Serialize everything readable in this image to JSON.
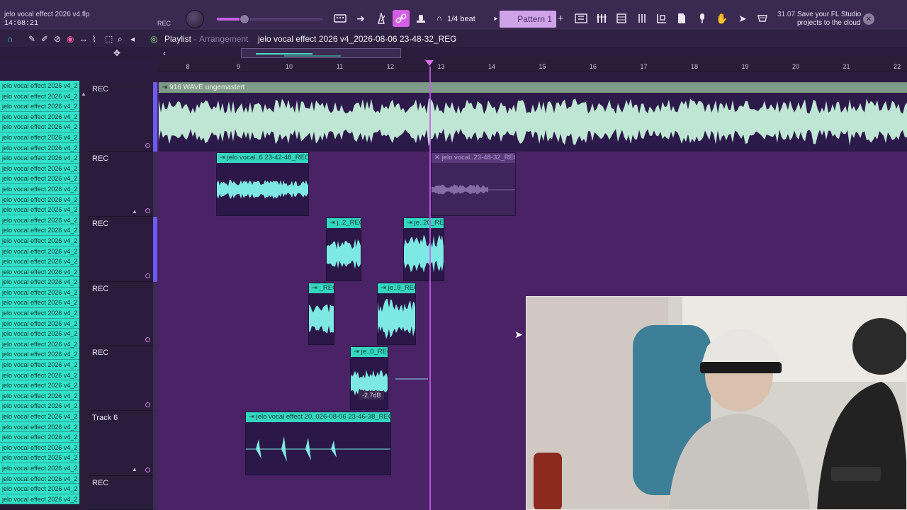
{
  "app": {
    "project_file": "jelo vocal effect 2026 v4.flp",
    "time": "14:08:21",
    "rec_label": "REC"
  },
  "toolbar": {
    "snap": "1/4 beat",
    "pattern": "Pattern 1",
    "pattern_add": "+",
    "cloud_count": "31.07",
    "cloud_message": "Save your FL Studio projects to the cloud",
    "icons": [
      "typing-keyboard-icon",
      "arrow-right-icon",
      "metronome-icon",
      "link-icon",
      "stamp-icon",
      "wait-icon",
      "mixer-icon",
      "channel-rack-icon",
      "piano-roll-icon",
      "browser-icon",
      "plugin-icon",
      "project-icon",
      "cloud-icon"
    ]
  },
  "playlist": {
    "title": "Playlist",
    "separator": "-",
    "subtitle": "Arrangement",
    "project_name": "jelo vocal effect 2026 v4_2026-08-06 23-48-32_REC",
    "crumb_arrow": "›"
  },
  "ruler": {
    "bars": [
      "8",
      "9",
      "10",
      "11",
      "12",
      "13",
      "14",
      "15",
      "16",
      "17",
      "18",
      "19",
      "20",
      "21",
      "22"
    ]
  },
  "clip_list": {
    "item_label": "jelo vocal effect 2026 v4_2",
    "count": 41
  },
  "tracks": [
    {
      "name": "REC",
      "accent": true
    },
    {
      "name": "REC",
      "accent": false
    },
    {
      "name": "REC",
      "accent": true
    },
    {
      "name": "REC",
      "accent": false
    },
    {
      "name": "REC",
      "accent": false
    },
    {
      "name": "Track 6",
      "accent": false
    },
    {
      "name": "REC",
      "accent": false
    }
  ],
  "clips": {
    "main_audio": "916 WAVE ungemastert",
    "track2_a": "jelo vocal..6 23-42-48_REC",
    "track2_b": "jelo vocal..23-48-32_REC",
    "track3_a": "j..2_REC",
    "track3_b": "je..20_REC",
    "track4_a": "_REC",
    "track4_b": "je..9_REC",
    "track5_a": "je..0_REC",
    "track6_a": "jelo vocal effect 20..026-08-06 23-46-38_REC",
    "gain": "-2.7dB"
  },
  "colors": {
    "clip_head": "#35d6c0",
    "playhead": "#c55fe6",
    "arrangement_bg": "#4a2366"
  }
}
